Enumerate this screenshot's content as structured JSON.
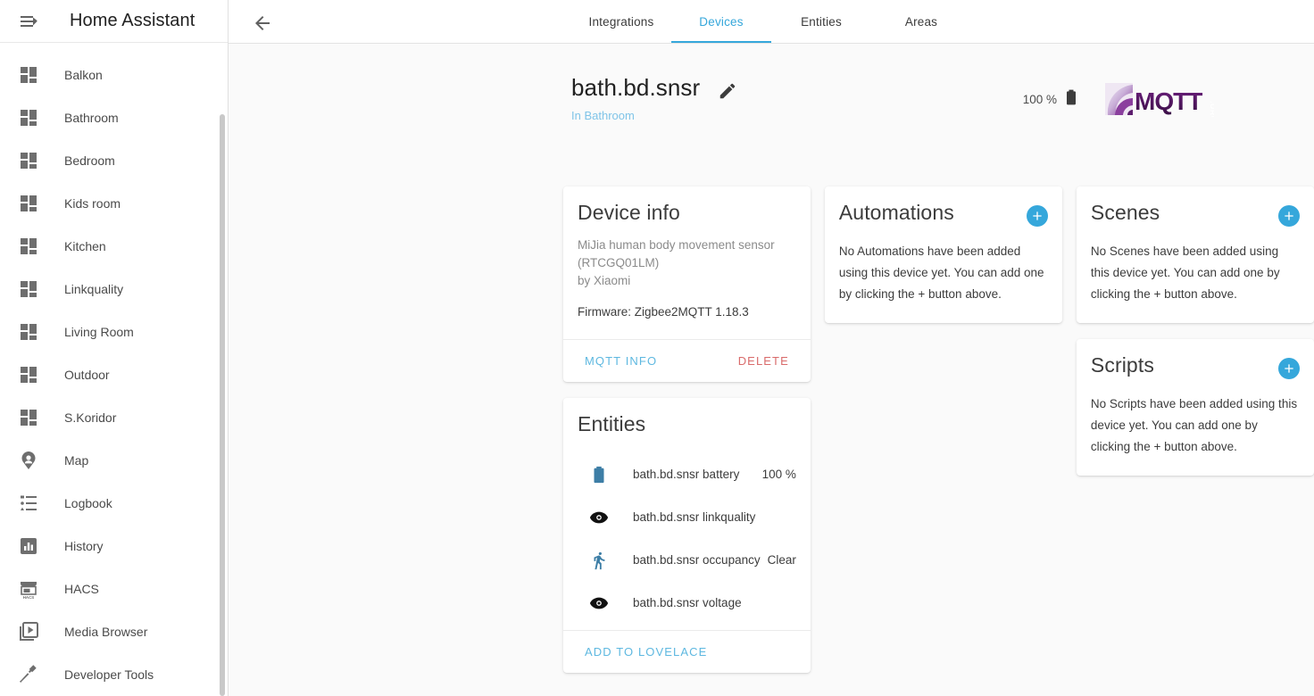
{
  "sidebar": {
    "title": "Home Assistant",
    "menu_icon": "menu-open-icon",
    "items": [
      {
        "label": "Balkon",
        "icon": "view-dashboard-icon"
      },
      {
        "label": "Bathroom",
        "icon": "view-dashboard-icon"
      },
      {
        "label": "Bedroom",
        "icon": "view-dashboard-icon"
      },
      {
        "label": "Kids room",
        "icon": "view-dashboard-icon"
      },
      {
        "label": "Kitchen",
        "icon": "view-dashboard-icon"
      },
      {
        "label": "Linkquality",
        "icon": "view-dashboard-icon"
      },
      {
        "label": "Living Room",
        "icon": "view-dashboard-icon"
      },
      {
        "label": "Outdoor",
        "icon": "view-dashboard-icon"
      },
      {
        "label": "S.Koridor",
        "icon": "view-dashboard-icon"
      },
      {
        "label": "Map",
        "icon": "map-marker-account-icon"
      },
      {
        "label": "Logbook",
        "icon": "format-list-bulleted-icon"
      },
      {
        "label": "History",
        "icon": "chart-box-icon"
      },
      {
        "label": "HACS",
        "icon": "hacs-storefront-icon"
      },
      {
        "label": "Media Browser",
        "icon": "play-box-multiple-icon"
      },
      {
        "label": "Developer Tools",
        "icon": "hammer-icon"
      }
    ]
  },
  "toolbar": {
    "back_icon": "arrow-left-icon",
    "tabs": [
      {
        "label": "Integrations",
        "active": false
      },
      {
        "label": "Devices",
        "active": true
      },
      {
        "label": "Entities",
        "active": false
      },
      {
        "label": "Areas",
        "active": false
      }
    ]
  },
  "device": {
    "name": "bath.bd.snsr",
    "edit_icon": "pencil-icon",
    "area": "In Bathroom",
    "battery_text": "100 %",
    "battery_icon": "battery-full-icon",
    "brand_logo": "mqtt-org-logo"
  },
  "device_info": {
    "title": "Device info",
    "model_line1": "MiJia human body movement sensor",
    "model_line2": "(RTCGQ01LM)",
    "manufacturer": "by Xiaomi",
    "firmware": "Firmware: Zigbee2MQTT 1.18.3",
    "mqtt_info_label": "MQTT INFO",
    "delete_label": "DELETE"
  },
  "entities_card": {
    "title": "Entities",
    "add_to_lovelace_label": "ADD TO LOVELACE",
    "rows": [
      {
        "icon": "battery-icon",
        "name": "bath.bd.snsr battery",
        "state": "100 %"
      },
      {
        "icon": "eye-icon",
        "name": "bath.bd.snsr linkquality",
        "state": ""
      },
      {
        "icon": "walk-icon",
        "name": "bath.bd.snsr occupancy",
        "state": "Clear"
      },
      {
        "icon": "eye-icon",
        "name": "bath.bd.snsr voltage",
        "state": ""
      }
    ]
  },
  "automations": {
    "title": "Automations",
    "add_icon": "plus-circle-icon",
    "empty_text": "No Automations have been added using this device yet. You can add one by clicking the + button above."
  },
  "scenes": {
    "title": "Scenes",
    "add_icon": "plus-circle-icon",
    "empty_text": "No Scenes have been added using this device yet. You can add one by clicking the + button above."
  },
  "scripts": {
    "title": "Scripts",
    "add_icon": "plus-circle-icon",
    "empty_text": "No Scripts have been added using this device yet. You can add one by clicking the + button above."
  },
  "colors": {
    "accent": "#35a7db",
    "link": "#7fc4e8",
    "danger": "#d96b6b",
    "background": "#fafafa",
    "sidebar_bg": "#ffffff"
  }
}
